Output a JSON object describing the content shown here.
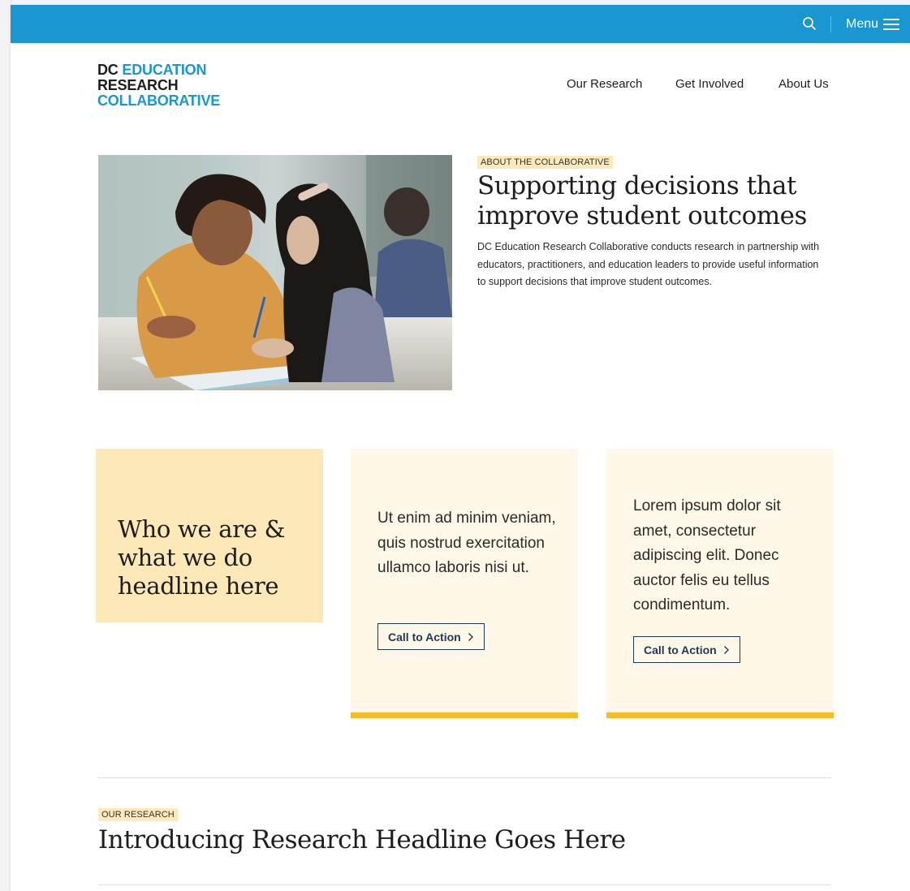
{
  "header": {
    "menu_label": "Menu",
    "search_icon": "search-icon",
    "menu_icon": "hamburger-menu-icon",
    "bar_color": "#1a96d1"
  },
  "logo": {
    "line1_dark": "DC",
    "line1_blue": "EDUCATION",
    "line2": "RESEARCH",
    "line3": "COLLABORATIVE"
  },
  "nav": {
    "items": [
      {
        "label": "Our Research"
      },
      {
        "label": "Get Involved"
      },
      {
        "label": "About Us"
      }
    ]
  },
  "hero": {
    "eyebrow": "ABOUT THE COLLABORATIVE",
    "title": "Supporting decisions that improve student outcomes",
    "body": "DC Education Research Collaborative conducts research in partnership with educators, practitioners, and education leaders to provide useful information to support decisions that improve student outcomes."
  },
  "cards": [
    {
      "title": "Who we are & what we do headline here"
    },
    {
      "text": "Ut enim ad minim veniam, quis nostrud exercitation ullamco laboris nisi ut.",
      "cta": "Call to Action"
    },
    {
      "text": "Lorem ipsum dolor sit amet, consectetur adipiscing elit. Donec auctor felis eu tellus condimentum.",
      "cta": "Call to Action"
    }
  ],
  "research": {
    "eyebrow": "OUR RESEARCH",
    "title": "Introducing Research Headline Goes Here"
  },
  "colors": {
    "accent_blue": "#1a96d1",
    "highlight_yellow": "#fde9b8",
    "card_cream": "#fff8e8",
    "card_border_gold": "#f4bd28",
    "cta_navy": "#1b3a56"
  }
}
